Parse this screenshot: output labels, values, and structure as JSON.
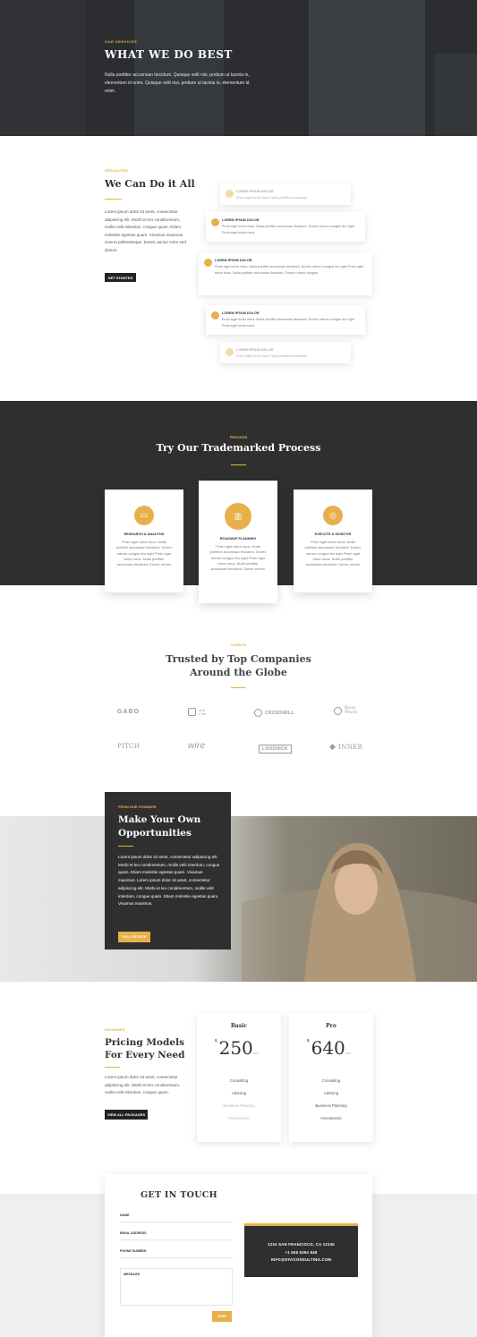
{
  "hero": {
    "eyebrow": "OUR SERVICES",
    "title": "WHAT WE DO BEST",
    "text": "Nulla porttitor accumsan tincidunt. Quisque velit nisi, pretium ut lacinia in, elementum id enim. Quisque velit nisi, pretium ut lacinia in, elementum id enim."
  },
  "services": {
    "eyebrow": "SPECIALTIES",
    "title": "We Can Do it All",
    "text": "Lorem ipsum dolor sit amet, consectetur adipiscing elit. Morbi et leo condimentum, mollis velit interdum, congue quam. Etiam molestie egestas quam. Vivamus maximus viverra pellentesque. Donec auctor enim sed dictum",
    "button": "GET STARTED",
    "items": [
      {
        "title": "LOREM IPSUM DOLOR",
        "text": "Proin eget tortor risus. Nulla porttitor accumsan",
        "icon": "cloud-icon"
      },
      {
        "title": "LOREM IPSUM DOLOR",
        "text": "Proin eget tortor risus. Nulla porttitor accumsan tincidunt. Donec rutrum congue leo eget Proin eget tortor risus.",
        "icon": "chart-icon"
      },
      {
        "title": "LOREM IPSUM DOLOR",
        "text": "Proin eget tortor risus. Nulla porttitor accumsan tincidunt. Donec rutrum congue leo eget Proin eget tortor risus. Nulla porttitor accumsan tincidunt. Donec rutrum congue",
        "icon": "cloud-icon"
      },
      {
        "title": "LOREM IPSUM DOLOR",
        "text": "Proin eget tortor risus. Nulla porttitor accumsan tincidunt. Donec rutrum congue leo eget Proin eget tortor risus.",
        "icon": "lightbulb-icon"
      },
      {
        "title": "LOREM IPSUM DOLOR",
        "text": "Proin eget tortor risus. Nulla porttitor accumsan",
        "icon": "gear-icon"
      }
    ]
  },
  "process": {
    "eyebrow": "PROCESS",
    "title": "Try Our Trademarked Process",
    "steps": [
      {
        "title": "RESEARCH & ANALYSIS",
        "text": "Proin eget tortor risus. Nulla porttitor accumsan tincidunt. Donec rutrum congue leo eget Proin eget tortor risus. Nulla porttitor accumsan tincidunt. Donec rutrum",
        "icon": "presentation-icon"
      },
      {
        "title": "ROADMAP PLANNING",
        "text": "Proin eget tortor risus. Nulla porttitor accumsan tincidunt. Donec rutrum congue leo eget Proin eget tortor risus. Nulla porttitor accumsan tincidunt. Donec rutrum",
        "icon": "map-icon"
      },
      {
        "title": "EXECUTE & MONITOR",
        "text": "Proin eget tortor risus. Nulla porttitor accumsan tincidunt. Donec rutrum congue leo eget Proin eget tortor risus. Nulla porttitor accumsan tincidunt. Donec rutrum",
        "icon": "target-icon"
      }
    ]
  },
  "clients": {
    "eyebrow": "CLIENTS",
    "title": "Trusted by Top Companies Around the Globe",
    "logos": [
      "GABO",
      "Job Link",
      "CROSSWILL",
      "Real Wave",
      "PITCH",
      "wire",
      "LOUDNICK",
      "INNER"
    ]
  },
  "founder": {
    "eyebrow": "FROM OUR FOUNDER",
    "title": "Make Your Own Opportunities",
    "text": "Lorem ipsum dolor sit amet, consectetur adipiscing elit. Morbi et leo condimentum, mollis velit interdum, congue quam. Etiam molestie egestas quam. Vivamus maximus. Lorem ipsum dolor sit amet, consectetur adipiscing elit. Morbi et leo condimentum, mollis velit interdum, congue quam. Etiam molestie egestas quam. Vivamus maximus.",
    "button": "FULL ARTICLE"
  },
  "pricing": {
    "eyebrow": "PACKAGES",
    "title": "Pricing Models For Every Need",
    "text": "Lorem ipsum dolor sit amet, consectetur adipiscing elit. Morbi et leo condimentum, mollis velit interdum, congue quam.",
    "button": "VIEW ALL PACKAGES",
    "tiers": [
      {
        "name": "Basic",
        "currency": "$",
        "price": "250",
        "per": "/mo",
        "features": [
          "Consulting",
          "Advising",
          "Business Planning",
          "Investments"
        ]
      },
      {
        "name": "Pro",
        "currency": "$",
        "price": "640",
        "per": "/mo",
        "features": [
          "Consulting",
          "Advising",
          "Business Planning",
          "Investments"
        ]
      }
    ]
  },
  "contact": {
    "title": "GET IN TOUCH",
    "fields": [
      "NAME",
      "EMAIL ADDRESS",
      "PHONE NUMBER"
    ],
    "message": "MESSAGE",
    "send": "SEND",
    "address": "1234 SAN FRANCISCO, CA 12345",
    "phone": "+1 555 5394 848",
    "email": "INFO@DIVICONSULTING.COM"
  },
  "colors": {
    "accent": "#e8b04b",
    "dark": "#2f2f2f"
  }
}
